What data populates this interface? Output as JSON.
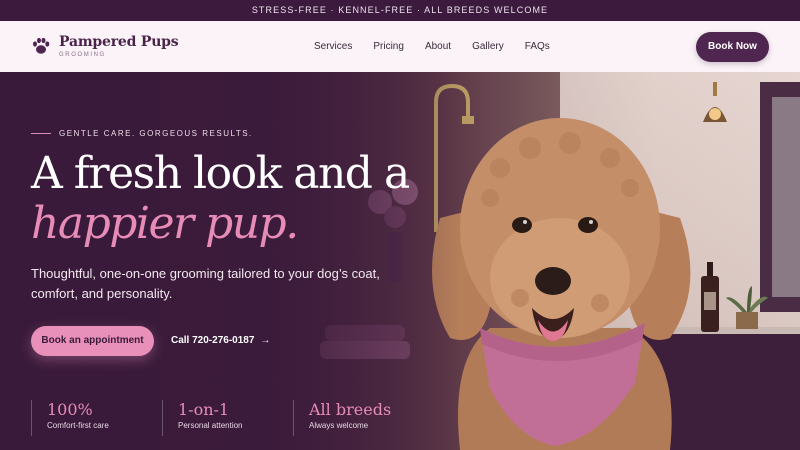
{
  "topbar": {
    "text": "STRESS-FREE · KENNEL-FREE · ALL BREEDS WELCOME"
  },
  "brand": {
    "name": "Pampered Pups",
    "tagline": "GROOMING"
  },
  "nav": {
    "items": [
      {
        "label": "Services"
      },
      {
        "label": "Pricing"
      },
      {
        "label": "About"
      },
      {
        "label": "Gallery"
      },
      {
        "label": "FAQs"
      }
    ],
    "cta": "Book Now"
  },
  "hero": {
    "eyebrow": "GENTLE CARE. GORGEOUS RESULTS.",
    "headline_line1": "A fresh look and a",
    "headline_line2": "happier pup.",
    "subtext": "Thoughtful, one-on-one grooming tailored to your dog’s coat, comfort, and personality.",
    "primary_cta": "Book an appointment",
    "call_text": "Call 720-276-0187",
    "call_arrow": "→"
  },
  "stats": [
    {
      "value": "100%",
      "label": "Comfort-first care"
    },
    {
      "value": "1-on-1",
      "label": "Personal attention"
    },
    {
      "value": "All breeds",
      "label": "Always welcome"
    }
  ],
  "colors": {
    "brand_dark": "#4e2650",
    "accent_pink": "#e88fba",
    "topbar_bg": "#3b1a3d",
    "nav_bg": "#fbf3f8"
  },
  "icons": {
    "logo": "paw-print-icon",
    "call_arrow": "arrow-right-icon"
  }
}
